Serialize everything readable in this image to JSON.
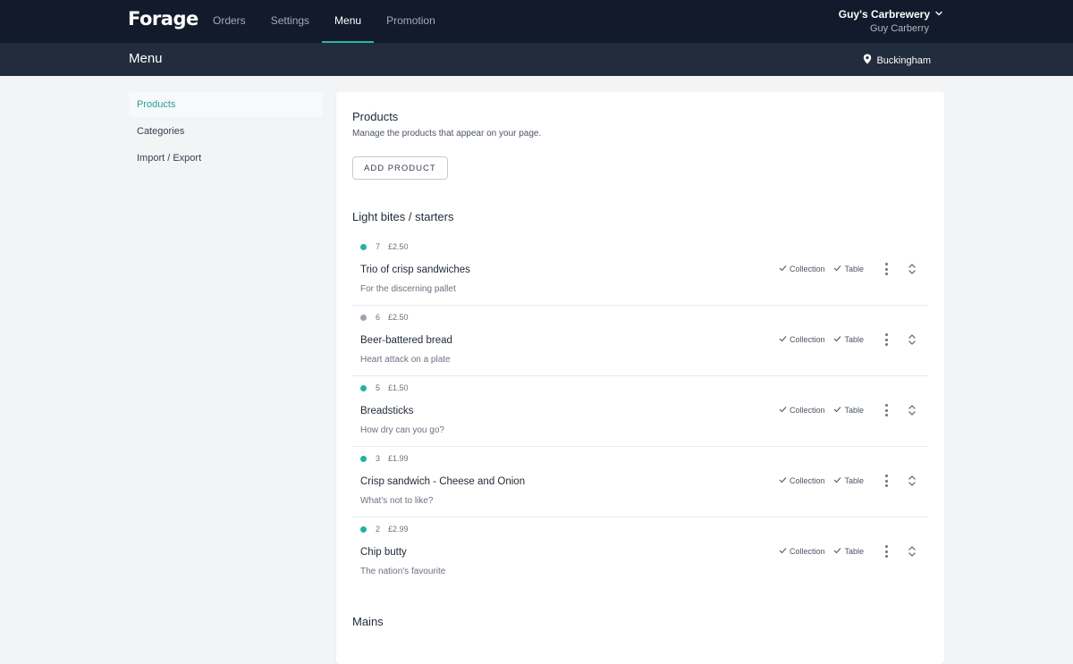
{
  "brand": {
    "logo": "Forage",
    "accent": "#2bb5a5"
  },
  "nav": {
    "items": [
      "Orders",
      "Settings",
      "Menu",
      "Promotion"
    ],
    "active": "Menu"
  },
  "account": {
    "business": "Guy's Carbrewery",
    "user": "Guy Carberry"
  },
  "subheader": {
    "title": "Menu",
    "location": "Buckingham"
  },
  "sidebar": {
    "items": [
      "Products",
      "Categories",
      "Import / Export"
    ],
    "active": "Products"
  },
  "products": {
    "title": "Products",
    "subtitle": "Manage the products that appear on your page.",
    "add_label": "ADD PRODUCT"
  },
  "sections": [
    {
      "title": "Light bites / starters",
      "items": [
        {
          "status": "active",
          "count": "7",
          "price": "£2.50",
          "name": "Trio of crisp sandwiches",
          "description": "For the discerning pallet",
          "tags": [
            "Collection",
            "Table"
          ]
        },
        {
          "status": "inactive",
          "count": "6",
          "price": "£2.50",
          "name": "Beer-battered bread",
          "description": "Heart attack on a plate",
          "tags": [
            "Collection",
            "Table"
          ]
        },
        {
          "status": "active",
          "count": "5",
          "price": "£1.50",
          "name": "Breadsticks",
          "description": "How dry can you go?",
          "tags": [
            "Collection",
            "Table"
          ]
        },
        {
          "status": "active",
          "count": "3",
          "price": "£1.99",
          "name": "Crisp sandwich - Cheese and Onion",
          "description": "What's not to like?",
          "tags": [
            "Collection",
            "Table"
          ]
        },
        {
          "status": "active",
          "count": "2",
          "price": "£2.99",
          "name": "Chip butty",
          "description": "The nation's favourite",
          "tags": [
            "Collection",
            "Table"
          ]
        }
      ]
    },
    {
      "title": "Mains",
      "items": []
    }
  ],
  "colors": {
    "topbar": "#121a2b",
    "subbar": "#212c3d",
    "status_active": "#1fb4a2",
    "status_inactive": "#9ca3af"
  }
}
